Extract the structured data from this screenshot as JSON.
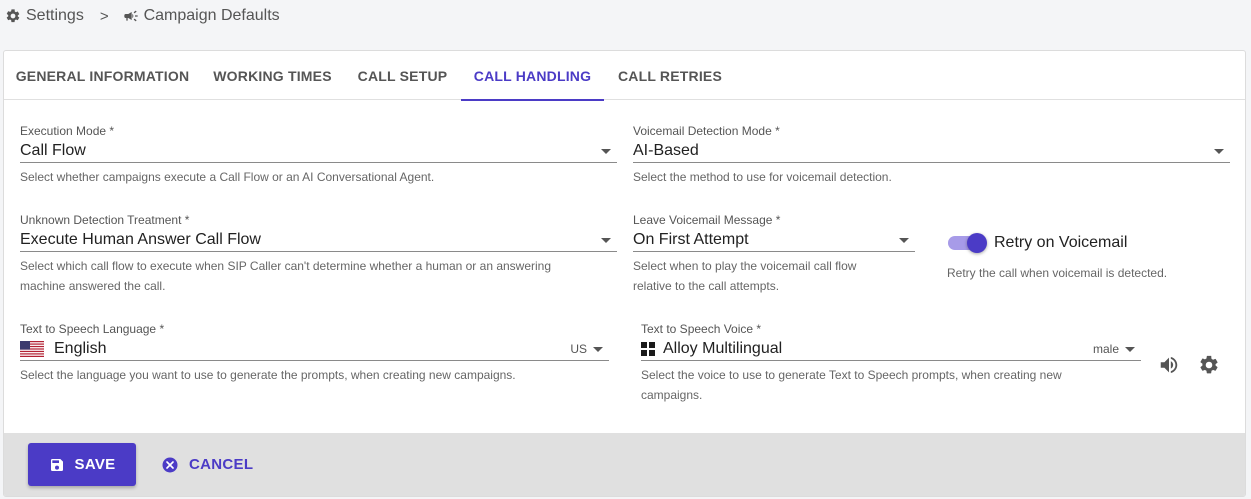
{
  "breadcrumb": {
    "items": [
      {
        "label": "Settings",
        "icon": "gear-icon"
      },
      {
        "label": "Campaign Defaults",
        "icon": "megaphone-icon"
      }
    ],
    "separator": ">"
  },
  "tabs": [
    {
      "label": "GENERAL INFORMATION",
      "active": false
    },
    {
      "label": "WORKING TIMES",
      "active": false
    },
    {
      "label": "CALL SETUP",
      "active": false
    },
    {
      "label": "CALL HANDLING",
      "active": true
    },
    {
      "label": "CALL RETRIES",
      "active": false
    }
  ],
  "fields": {
    "execution_mode": {
      "label": "Execution Mode *",
      "value": "Call Flow",
      "helper": "Select whether campaigns execute a Call Flow or an AI Conversational Agent."
    },
    "voicemail_detection_mode": {
      "label": "Voicemail Detection Mode *",
      "value": "AI-Based",
      "helper": "Select the method to use for voicemail detection."
    },
    "unknown_detection_treatment": {
      "label": "Unknown Detection Treatment *",
      "value": "Execute Human Answer Call Flow",
      "helper_line1": "Select which call flow to execute when SIP Caller can't determine whether a human or an answering",
      "helper_line2": "machine answered the call."
    },
    "leave_voicemail_message": {
      "label": "Leave Voicemail Message *",
      "value": "On First Attempt",
      "helper_line1": "Select when to play the voicemail call flow",
      "helper_line2": "relative to the call attempts."
    },
    "retry_on_voicemail": {
      "label": "Retry on Voicemail",
      "enabled": true,
      "helper": "Retry the call when voicemail is detected."
    },
    "tts_language": {
      "label": "Text to Speech Language *",
      "value": "English",
      "suffix": "US",
      "icon": "us-flag-icon",
      "helper": "Select the language you want to use to generate the prompts, when creating new campaigns."
    },
    "tts_voice": {
      "label": "Text to Speech Voice *",
      "value": "Alloy Multilingual",
      "suffix": "male",
      "icon": "windows-logo-icon",
      "helper_line1": "Select the voice to use to generate Text to Speech prompts, when creating new",
      "helper_line2": "campaigns."
    }
  },
  "footer": {
    "save_label": "SAVE",
    "cancel_label": "CANCEL"
  },
  "colors": {
    "accent": "#4b3bc6",
    "toggle_track": "#a79be8",
    "footer_bg": "#e0e0e0"
  }
}
